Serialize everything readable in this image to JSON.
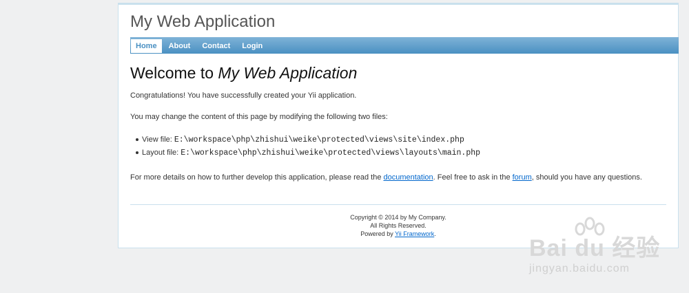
{
  "header": {
    "title": "My Web Application"
  },
  "menu": {
    "items": [
      {
        "label": "Home"
      },
      {
        "label": "About"
      },
      {
        "label": "Contact"
      },
      {
        "label": "Login"
      }
    ]
  },
  "content": {
    "heading_prefix": "Welcome to ",
    "heading_app": "My Web Application",
    "congrats": "Congratulations! You have successfully created your Yii application.",
    "change_text": "You may change the content of this page by modifying the following two files:",
    "files": [
      {
        "label": "View file: ",
        "path": "E:\\workspace\\php\\zhishui\\weike\\protected\\views\\site\\index.php"
      },
      {
        "label": "Layout file: ",
        "path": "E:\\workspace\\php\\zhishui\\weike\\protected\\views\\layouts\\main.php"
      }
    ],
    "details_before": "For more details on how to further develop this application, please read the ",
    "documentation_link": "documentation",
    "details_mid": ". Feel free to ask in the ",
    "forum_link": "forum",
    "details_after": ", should you have any questions."
  },
  "footer": {
    "copyright": "Copyright © 2014 by My Company.",
    "rights": "All Rights Reserved.",
    "powered_prefix": "Powered by ",
    "powered_link": "Yii Framework",
    "powered_suffix": "."
  },
  "watermark": {
    "brand": "Bai du 经验",
    "url": "jingyan.baidu.com"
  }
}
